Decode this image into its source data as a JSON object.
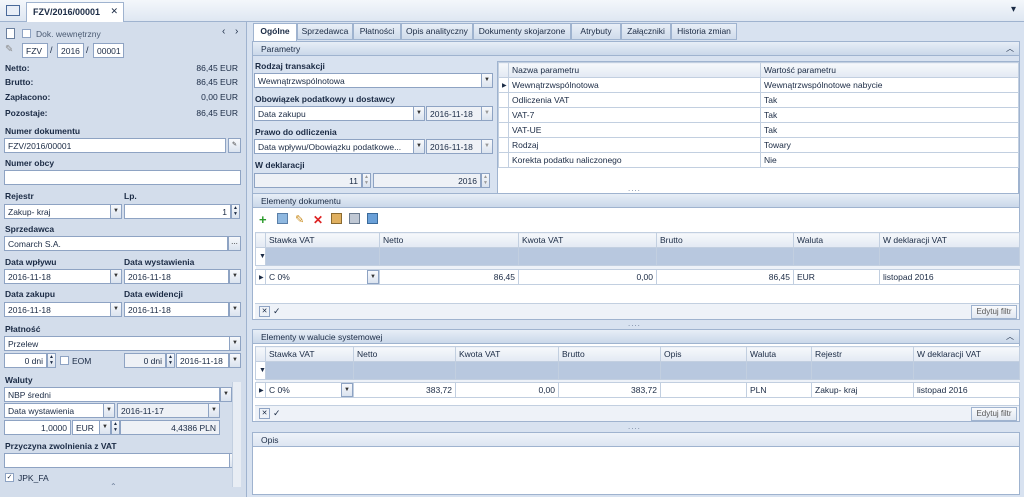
{
  "toolbar": {
    "doc_tab": "FZV/2016/00001",
    "close": "✕",
    "dropdown": "▾"
  },
  "left": {
    "internal_doc": "Dok. wewnętrzny",
    "prefix": "FZV",
    "year": "2016",
    "number": "00001",
    "sep": "/",
    "summary": [
      {
        "label": "Netto:",
        "value": "86,45 EUR"
      },
      {
        "label": "Brutto:",
        "value": "86,45 EUR"
      },
      {
        "label": "Zapłacono:",
        "value": "0,00 EUR"
      },
      {
        "label": "Pozostaje:",
        "value": "86,45 EUR"
      }
    ],
    "numer_dokumentu_label": "Numer dokumentu",
    "numer_dokumentu": "FZV/2016/00001",
    "numer_obcy_label": "Numer obcy",
    "numer_obcy": "",
    "rejestr_label": "Rejestr",
    "rejestr": "Zakup- kraj",
    "lp_label": "Lp.",
    "lp": "1",
    "sprzedawca_label": "Sprzedawca",
    "sprzedawca": "Comarch S.A.",
    "ellipsis": "...",
    "data_wplywu_label": "Data wpływu",
    "data_wplywu": "2016-11-18",
    "data_wystawienia_label": "Data wystawienia",
    "data_wystawienia": "2016-11-18",
    "data_zakupu_label": "Data zakupu",
    "data_zakupu": "2016-11-18",
    "data_ewidencji_label": "Data ewidencji",
    "data_ewidencji": "2016-11-18",
    "platnosc_label": "Płatność",
    "platnosc": "Przelew",
    "dni1": "0 dni",
    "eom": "EOM",
    "dni2": "0 dni",
    "termin": "2016-11-18",
    "waluty_label": "Waluty",
    "kurs_typ": "NBP średni",
    "kurs_data_typ": "Data wystawienia",
    "kurs_data": "2016-11-17",
    "kurs_ilosc": "1,0000",
    "kurs_waluta": "EUR",
    "kurs_wartosc": "4,4386 PLN",
    "zwolnienie_label": "Przyczyna zwolnienia z VAT",
    "zwolnienie": "",
    "jpk": "JPK_FA"
  },
  "tabs": [
    "Ogólne",
    "Sprzedawca",
    "Płatności",
    "Opis analityczny",
    "Dokumenty skojarzone",
    "Atrybuty",
    "Załączniki",
    "Historia zmian"
  ],
  "parametry": {
    "title": "Parametry",
    "rodzaj_label": "Rodzaj transakcji",
    "rodzaj": "Wewnątrzwspólnotowa",
    "obowiazek_label": "Obowiązek podatkowy u dostawcy",
    "obowiazek": "Data zakupu",
    "obowiazek_data": "2016-11-18",
    "prawo_label": "Prawo do odliczenia",
    "prawo": "Data wpływu/Obowiązku podatkowe...",
    "prawo_data": "2016-11-18",
    "deklaracja_label": "W deklaracji",
    "deklaracja_mies": "11",
    "deklaracja_rok": "2016",
    "grid_headers": [
      "Nazwa parametru",
      "Wartość parametru"
    ],
    "grid_rows": [
      [
        "Wewnątrzwspólnotowa",
        "Wewnątrzwspólnotowe nabycie"
      ],
      [
        "Odliczenia VAT",
        "Tak"
      ],
      [
        "VAT-7",
        "Tak"
      ],
      [
        "VAT-UE",
        "Tak"
      ],
      [
        "Rodzaj",
        "Towary"
      ],
      [
        "Korekta podatku naliczonego",
        "Nie"
      ]
    ]
  },
  "elementy": {
    "title": "Elementy dokumentu",
    "headers": [
      "Stawka VAT",
      "Netto",
      "Kwota VAT",
      "Brutto",
      "Waluta",
      "W deklaracji VAT"
    ],
    "row": [
      "C 0%",
      "86,45",
      "0,00",
      "86,45",
      "EUR",
      "listopad 2016"
    ],
    "edit_filter": "Edytuj filtr"
  },
  "systemowa": {
    "title": "Elementy w walucie systemowej",
    "headers": [
      "Stawka VAT",
      "Netto",
      "Kwota VAT",
      "Brutto",
      "Opis",
      "Waluta",
      "Rejestr",
      "W deklaracji VAT"
    ],
    "row": [
      "C 0%",
      "383,72",
      "0,00",
      "383,72",
      "",
      "PLN",
      "Zakup- kraj",
      "listopad 2016"
    ],
    "edit_filter": "Edytuj filtr"
  },
  "opis": {
    "title": "Opis"
  },
  "colors": {
    "panel_header": "#cad8ea",
    "accent": "#1a2a44",
    "filter_row": "#b8c8df"
  }
}
